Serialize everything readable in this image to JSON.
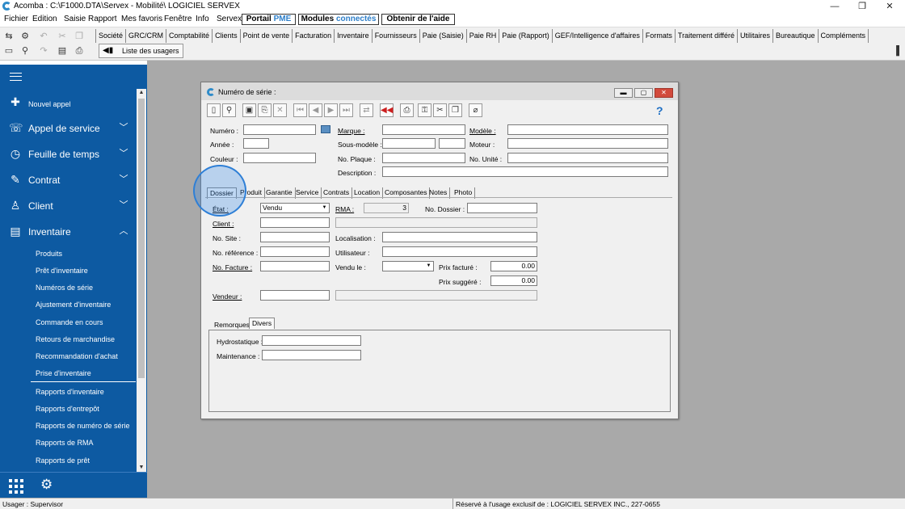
{
  "window": {
    "title": "Acomba : C:\\F1000.DTA\\Servex - Mobilité\\  LOGICIEL SERVEX",
    "controls": [
      "—",
      "❐",
      "✕"
    ]
  },
  "menu": {
    "items": [
      "Fichier",
      "Edition",
      "Saisie",
      "Rapport",
      "Mes favoris",
      "Fenêtre",
      "Info",
      "Servex"
    ],
    "buttons": {
      "portail": {
        "a": "Portail ",
        "b": "PME"
      },
      "modules": {
        "a": "Modules ",
        "b": "connectés"
      },
      "aide": "Obtenir de l'aide"
    }
  },
  "toolbar": {
    "module_tabs": [
      "Société",
      "GRC/CRM",
      "Comptabilité",
      "Clients",
      "Point de vente",
      "Facturation",
      "Inventaire",
      "Fournisseurs",
      "Paie (Saisie)",
      "Paie RH",
      "Paie (Rapport)",
      "GEF/Intelligence d'affaires",
      "Formats",
      "Traitement différé",
      "Utilitaires",
      "Bureautique",
      "Compléments"
    ],
    "user_list": "Liste des usagers"
  },
  "sidebar": {
    "nouvel_appel": "Nouvel appel",
    "appel_service": "Appel de service",
    "feuille_temps": "Feuille de temps",
    "contrat": "Contrat",
    "client": "Client",
    "inventaire": "Inventaire",
    "sub_items": [
      "Produits",
      "Prêt d'inventaire",
      "Numéros de série",
      "Ajustement d'inventaire",
      "Commande en cours",
      "Retours de marchandise",
      "Recommandation d'achat",
      "Prise d'inventaire",
      "Rapports d'inventaire",
      "Rapports d'entrepôt",
      "Rapports de numéro de série",
      "Rapports de RMA",
      "Rapports de prêt"
    ]
  },
  "dialog": {
    "title": "Numéro de série :",
    "help": "?",
    "labels": {
      "numero": "Numéro :",
      "marque": "Marque :",
      "modele": "Modèle :",
      "annee": "Année :",
      "sous_modele": "Sous-modèle :",
      "moteur": "Moteur :",
      "couleur": "Couleur :",
      "no_plaque": "No. Plaque :",
      "no_unite": "No. Unité :",
      "description": "Description :"
    },
    "tabs": [
      "Dossier",
      "Produit",
      "Garantie",
      "Service",
      "Contrats",
      "Location",
      "Composantes",
      "Notes",
      "Photo"
    ],
    "dossier": {
      "etat_label": "État :",
      "etat_value": "Vendu",
      "rma_label": "RMA :",
      "rma_value": "3",
      "no_dossier_label": "No. Dossier :",
      "client_label": "Client :",
      "no_site_label": "No. Site :",
      "localisation_label": "Localisation :",
      "no_reference_label": "No. référence :",
      "utilisateur_label": "Utilisateur :",
      "no_facture_label": "No. Facture :",
      "vendu_le_label": "Vendu le :",
      "prix_facture_label": "Prix facturé :",
      "prix_facture_value": "0.00",
      "prix_suggere_label": "Prix suggéré :",
      "prix_suggere_value": "0.00",
      "vendeur_label": "Vendeur :"
    },
    "subtabs": [
      "Remorques",
      "Divers"
    ],
    "divers": {
      "hydrostatique_label": "Hydrostatique :",
      "maintenance_label": "Maintenance :"
    }
  },
  "status": {
    "user": "Usager : Supervisor",
    "reserved": "Réservé à l'usage exclusif de : LOGICIEL SERVEX INC., 227-0655"
  }
}
